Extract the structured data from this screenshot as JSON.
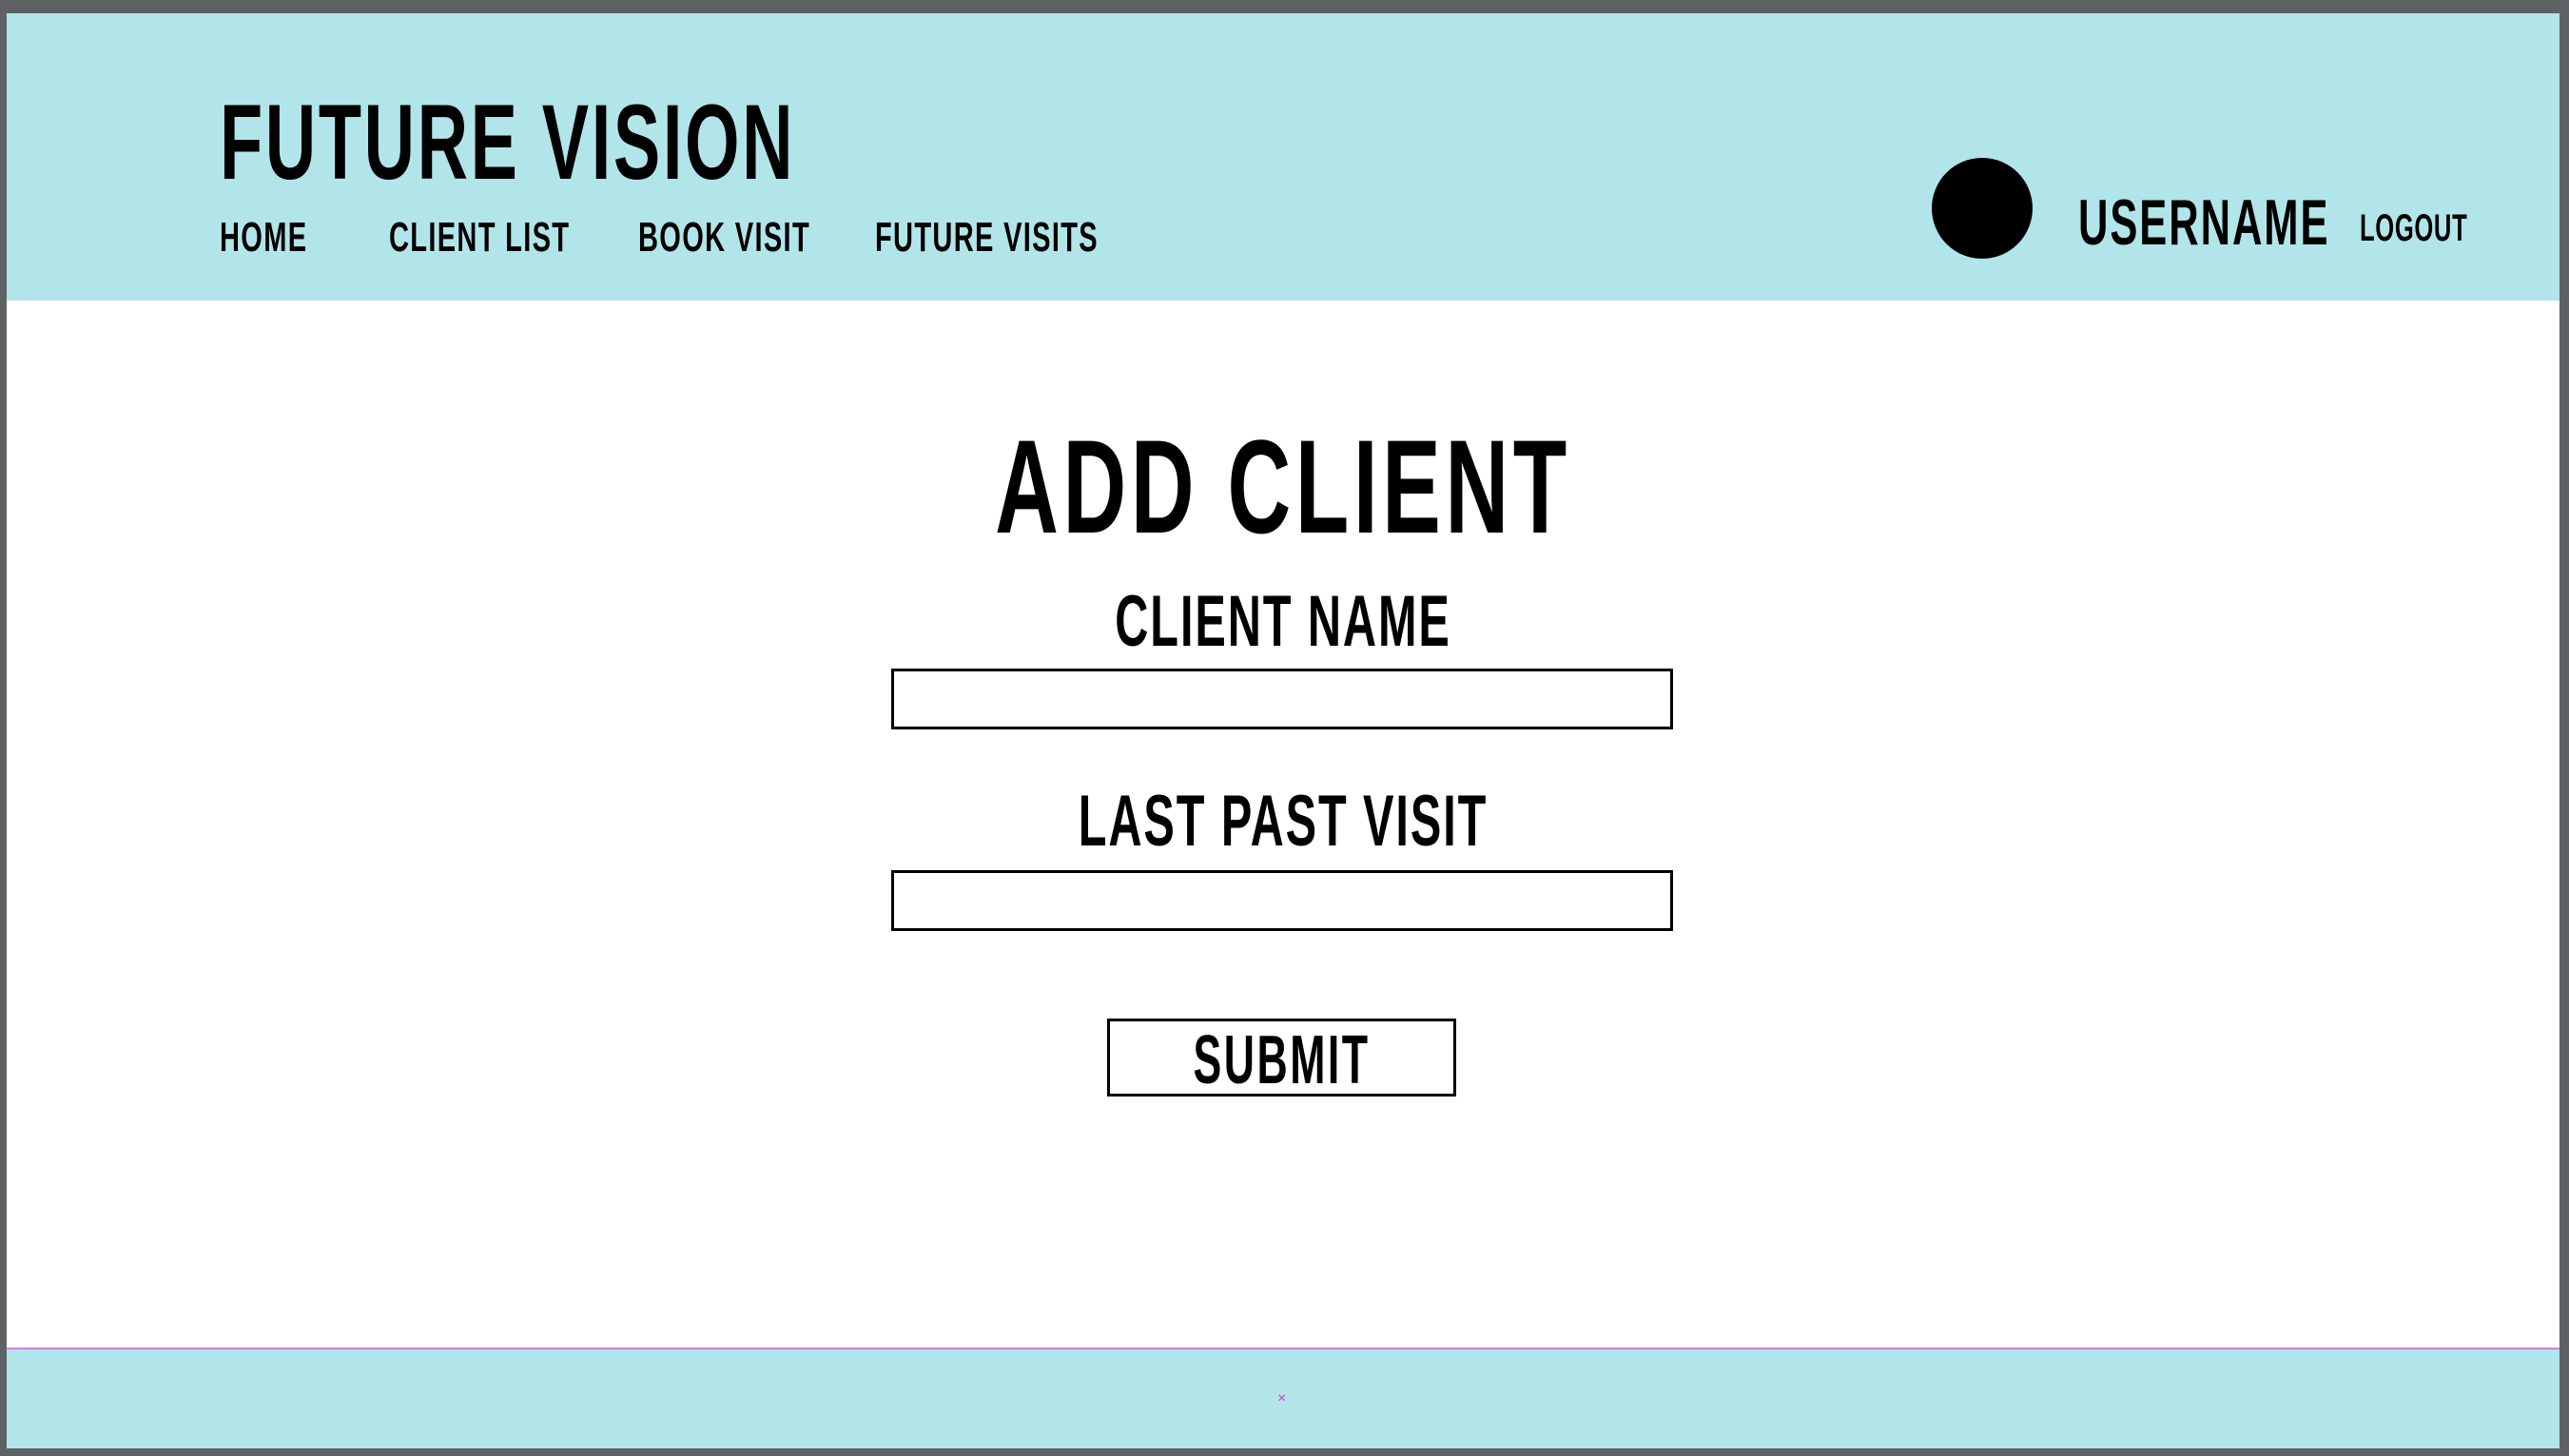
{
  "header": {
    "brand": "FUTURE VISION",
    "nav": [
      {
        "label": "HOME"
      },
      {
        "label": "CLIENT LIST"
      },
      {
        "label": "BOOK VISIT"
      },
      {
        "label": "FUTURE VISITS"
      }
    ],
    "user": {
      "avatar_icon": "user-avatar-circle",
      "username": "USERNAME",
      "logout_label": "LOGOUT"
    }
  },
  "main": {
    "title": "ADD CLIENT",
    "fields": [
      {
        "label": "CLIENT NAME",
        "value": "",
        "placeholder": ""
      },
      {
        "label": "LAST PAST VISIT",
        "value": "",
        "placeholder": ""
      }
    ],
    "submit_label": "SUBMIT"
  },
  "footer": {
    "mark_icon": "close-x-icon",
    "mark_glyph": "×"
  },
  "colors": {
    "header_bg": "#b2e5ea",
    "footer_bg": "#b2e5ea",
    "text": "#000000",
    "window_border": "#5f6265",
    "footer_accent": "#d97bd9"
  }
}
